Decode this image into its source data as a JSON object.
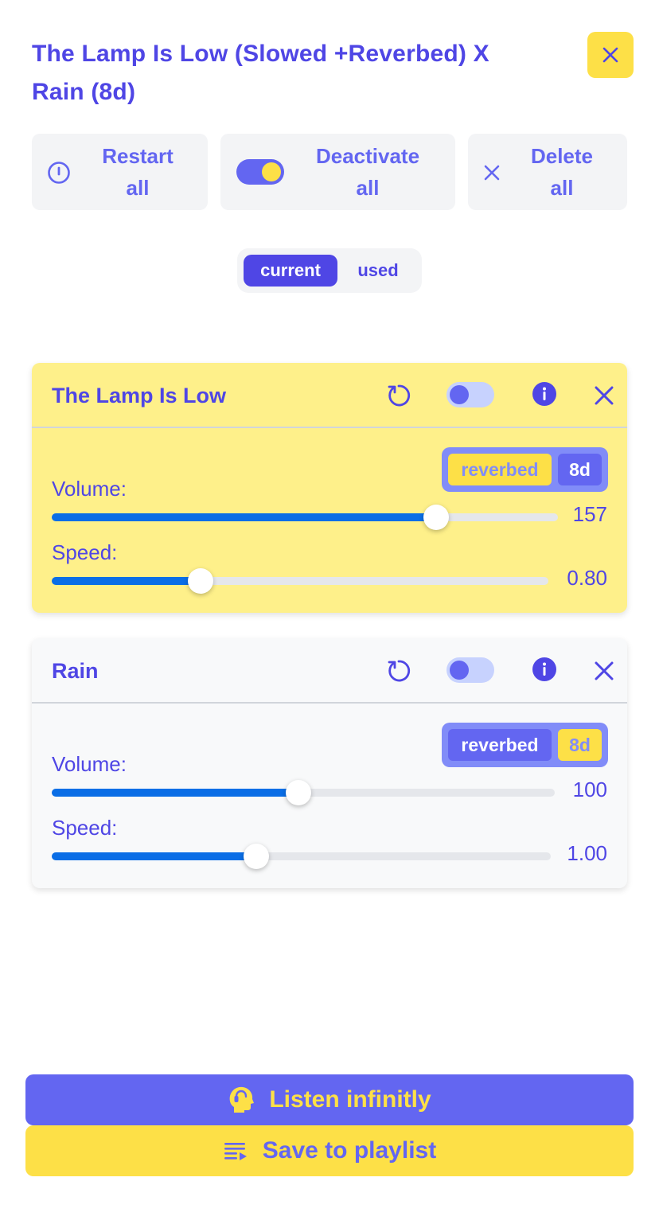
{
  "header": {
    "title": "The Lamp Is Low (Slowed +Reverbed) X Rain (8d)"
  },
  "actions": {
    "restart_line1": "Restart",
    "restart_line2": "all",
    "deactivate_line1": "Deactivate",
    "deactivate_line2": "all",
    "delete_line1": "Delete",
    "delete_line2": "all",
    "deactivate_toggle_on": true
  },
  "tabs": {
    "current": "current",
    "used": "used",
    "selected": "current"
  },
  "tracks": [
    {
      "name": "The Lamp Is Low",
      "tags": [
        "reverbed",
        "8d"
      ],
      "active_tag": "8d",
      "volume_label": "Volume:",
      "volume_value": "157",
      "volume_fraction": 0.76,
      "speed_label": "Speed:",
      "speed_value": "0.80",
      "speed_fraction": 0.3,
      "highlighted": true
    },
    {
      "name": "Rain",
      "tags": [
        "reverbed",
        "8d"
      ],
      "active_tag": "reverbed",
      "volume_label": "Volume:",
      "volume_value": "100",
      "volume_fraction": 0.49,
      "speed_label": "Speed:",
      "speed_value": "1.00",
      "speed_fraction": 0.41,
      "highlighted": false
    }
  ],
  "footer": {
    "listen_label": "Listen infinitly",
    "save_label": "Save to playlist"
  },
  "colors": {
    "primary": "#4f46e5",
    "primary_light": "#6366f1",
    "accent_yellow": "#fde047",
    "highlight_card": "#fef08a",
    "slider_fill": "#0a6ee6"
  }
}
